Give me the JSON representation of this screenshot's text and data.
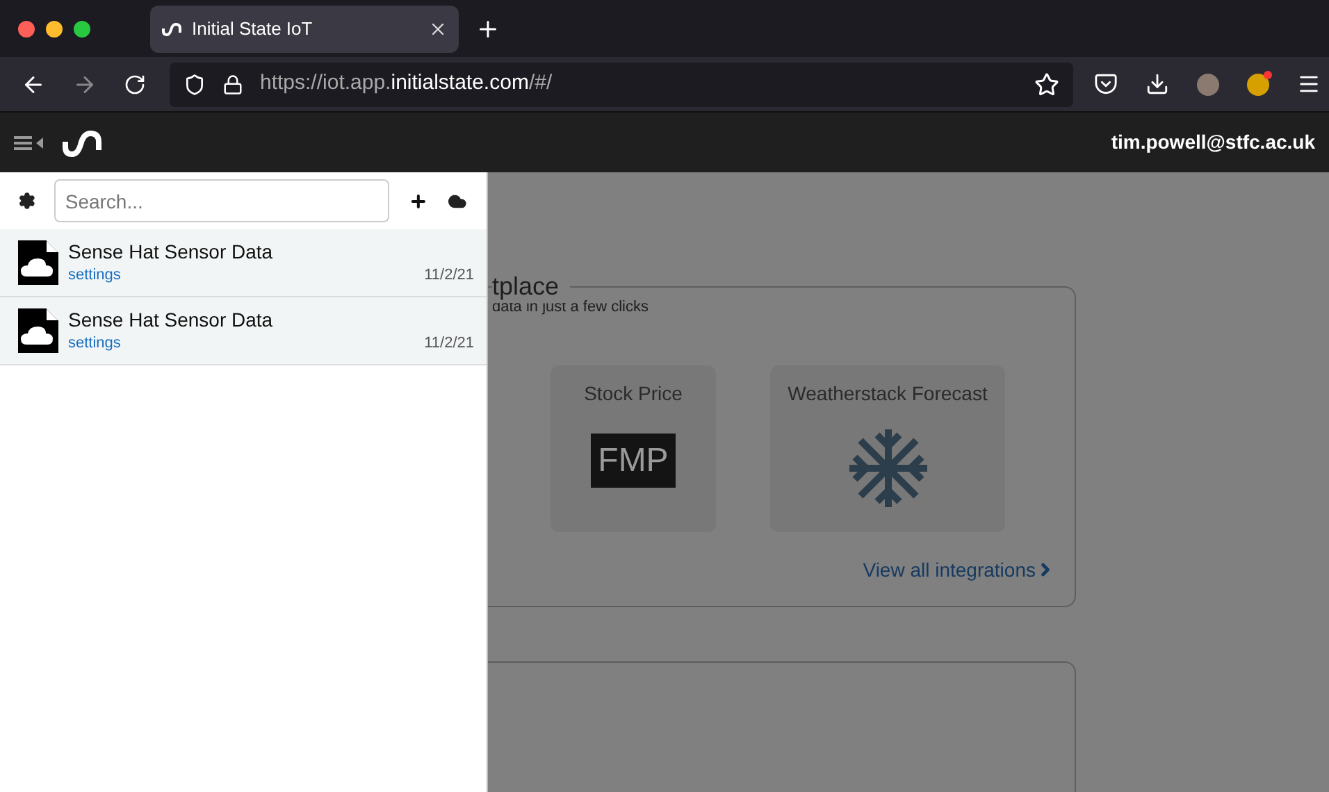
{
  "browser": {
    "tab": {
      "title": "Initial State IoT"
    },
    "url": {
      "prefix": "https://iot.app.",
      "host": "initialstate.com",
      "suffix": "/#/"
    }
  },
  "header": {
    "user": "tim.powell@stfc.ac.uk"
  },
  "sidebar": {
    "search": {
      "placeholder": "Search..."
    },
    "items": [
      {
        "title": "Sense Hat Sensor Data",
        "link": "settings",
        "date": "11/2/21"
      },
      {
        "title": "Sense Hat Sensor Data",
        "link": "settings",
        "date": "11/2/21"
      }
    ]
  },
  "marketplace": {
    "heading": "tplace",
    "subtitle": "data in just a few clicks",
    "tiles": [
      {
        "kind": "text-logo",
        "title": "Stock Price",
        "logo": "FMP"
      },
      {
        "kind": "icon",
        "title": "Weatherstack Forecast"
      }
    ],
    "link": "View all integrations"
  }
}
